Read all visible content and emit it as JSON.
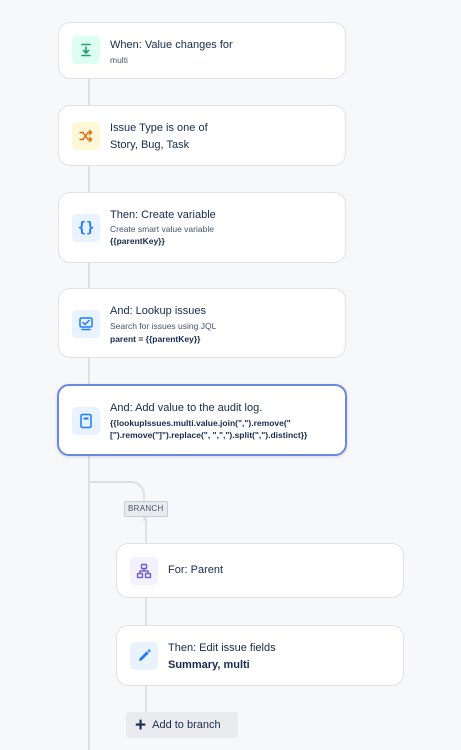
{
  "trigger": {
    "title": "When: Value changes for",
    "subtitle": "multi",
    "icon": "field-change-icon"
  },
  "condition": {
    "title": "Issue Type is one of",
    "value": "Story, Bug, Task",
    "icon": "shuffle-icon"
  },
  "create_variable": {
    "title": "Then: Create variable",
    "subtitle": "Create smart value variable",
    "detail": "{{parentKey}}",
    "icon": "braces-icon"
  },
  "lookup": {
    "title": "And: Lookup issues",
    "subtitle": "Search for issues using JQL",
    "detail": "parent = {{parentKey}}",
    "icon": "lookup-icon"
  },
  "audit_log": {
    "title": "And: Add value to the audit log.",
    "detail_line1": "{{lookupIssues.multi.value.join(\",\").remove(\"",
    "detail_line2": "[\").remove(\"]\").replace(\", \",\",\").split(\",\").distinct}}",
    "icon": "log-icon"
  },
  "branch": {
    "tag": "BRANCH",
    "for_card": {
      "title": "For: Parent",
      "icon": "hierarchy-icon"
    },
    "edit_card": {
      "title": "Then: Edit issue fields",
      "detail_bold": "Summary",
      "detail_rest": ", multi",
      "icon": "pencil-icon"
    },
    "add_button": "Add to branch"
  },
  "colors": {
    "trigger_bg": "#dcfff1",
    "trigger_fg": "#22a06b",
    "condition_bg": "#fff7d6",
    "condition_fg": "#e56910",
    "action_bg": "#e9f2ff",
    "action_fg": "#1d7afc",
    "branch_bg": "#f3f0ff",
    "branch_fg": "#6e5dc6",
    "selected_border": "#6d87e0"
  }
}
